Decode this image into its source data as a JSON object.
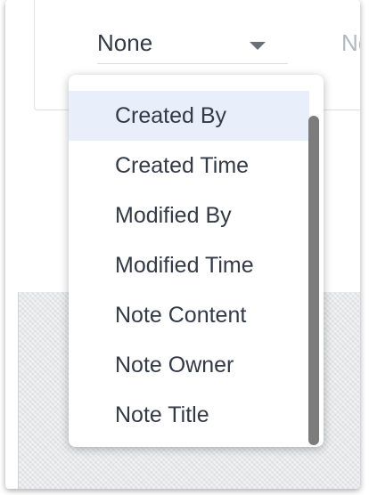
{
  "filter": {
    "field_select_value": "None",
    "second_select_value": "Nor"
  },
  "dropdown": {
    "highlighted_index": 0,
    "options": [
      "Created By",
      "Created Time",
      "Modified By",
      "Modified Time",
      "Note Content",
      "Note Owner",
      "Note Title"
    ]
  },
  "colors": {
    "highlight": "#e8effa",
    "text": "#333a45",
    "scrollbar": "#7c7c7c"
  }
}
